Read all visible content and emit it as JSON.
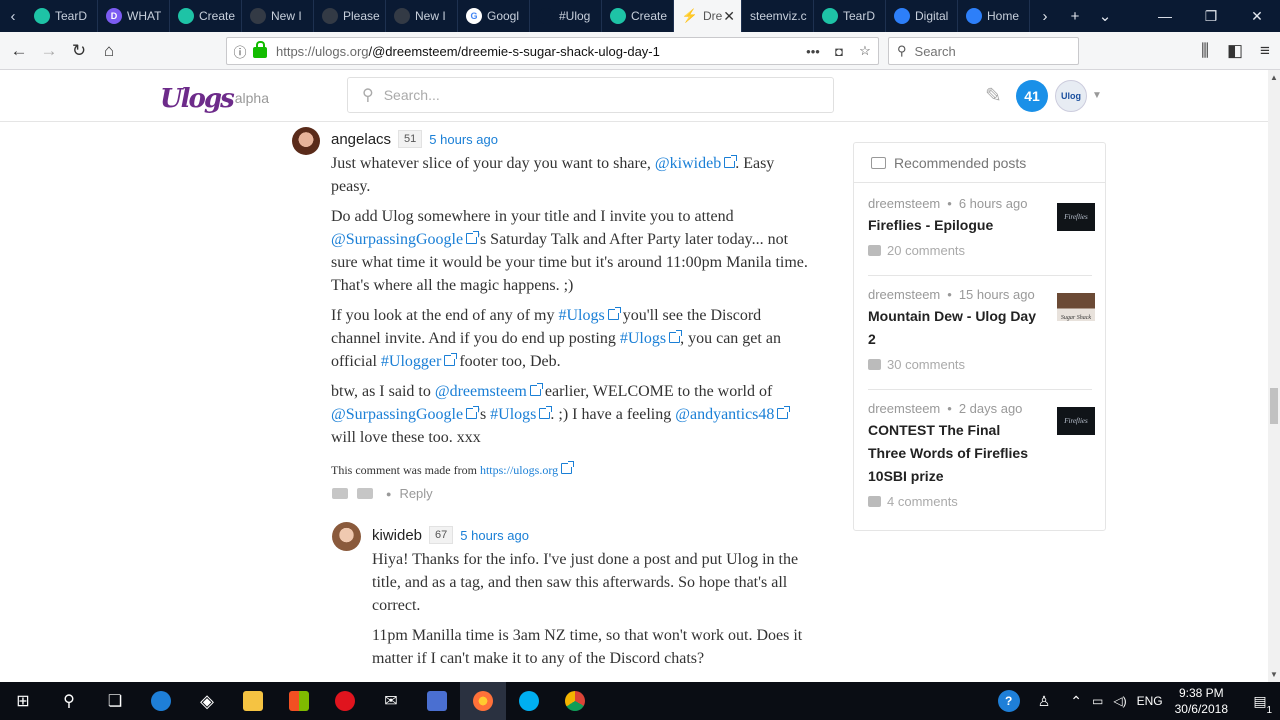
{
  "browser": {
    "tabs": [
      {
        "label": "TearD",
        "icon": "steemit-icon",
        "color": "#1ec3a6"
      },
      {
        "label": "WHAT",
        "icon": "discord-icon",
        "color": "#7c5cf2"
      },
      {
        "label": "Create",
        "icon": "steemit-icon",
        "color": "#1ec3a6"
      },
      {
        "label": "New I",
        "icon": "github-icon",
        "color": "#333a45"
      },
      {
        "label": "Please",
        "icon": "github-icon",
        "color": "#333a45"
      },
      {
        "label": "New I",
        "icon": "github-icon",
        "color": "#333a45"
      },
      {
        "label": "Googl",
        "icon": "google-icon",
        "color": "#ffffff"
      },
      {
        "label": "#Ulog",
        "icon": "ulog-icon",
        "color": "#0a1a33"
      },
      {
        "label": "Create",
        "icon": "steemit-icon",
        "color": "#1ec3a6"
      },
      {
        "label": "Dre",
        "icon": "lightning-icon",
        "color": "#f5f6f7",
        "active": true
      },
      {
        "label": "steemviz.c",
        "icon": "none",
        "color": "#0a1a33"
      },
      {
        "label": "TearD",
        "icon": "steemit-icon",
        "color": "#1ec3a6"
      },
      {
        "label": "Digital",
        "icon": "busy-icon",
        "color": "#2d7ff9"
      },
      {
        "label": "Home",
        "icon": "busy-icon",
        "color": "#2d7ff9"
      }
    ],
    "url_prefix": "https://ulogs.org",
    "url_path": "/@dreemsteem/dreemie-s-sugar-shack-ulog-day-1",
    "search_placeholder": "Search"
  },
  "site": {
    "logo_text": "Ulogs",
    "logo_suffix": "alpha",
    "search_placeholder": "Search...",
    "notification_count": "41",
    "avatar_text": "Ulog"
  },
  "comments": [
    {
      "author": "angelacs",
      "reputation": "51",
      "time": "5 hours ago",
      "p1_a": "Just whatever slice of your day you want to share, ",
      "p1_link": "@kiwideb",
      "p1_b": ". Easy peasy.",
      "p2_a": "Do add Ulog somewhere in your title and I invite you to attend ",
      "p2_link": "@SurpassingGoogle",
      "p2_b": "'s Saturday Talk and After Party later today... not sure what time it would be your time but it's around 11:00pm Manila time. That's where all the magic happens. ;)",
      "p3_a": "If you look at the end of any of my ",
      "p3_link1": "#Ulogs",
      "p3_b": " you'll see the Discord channel invite. And if you do end up posting ",
      "p3_link2": "#Ulogs",
      "p3_c": ", you can get an official ",
      "p3_link3": "#Ulogger",
      "p3_d": " footer too, Deb.",
      "p4_a": "btw, as I said to ",
      "p4_link1": "@dreemsteem",
      "p4_b": " earlier, WELCOME to the world of ",
      "p4_link2": "@SurpassingGoogle",
      "p4_c": "'s ",
      "p4_link3": "#Ulogs",
      "p4_d": ". ;) I have a feeling ",
      "p4_link4": "@andyantics48",
      "p4_e": " will love these too. xxx",
      "made_from": "This comment was made from ",
      "made_from_link": "https://ulogs.org",
      "reply": "Reply"
    },
    {
      "author": "kiwideb",
      "reputation": "67",
      "time": "5 hours ago",
      "p1": "Hiya! Thanks for the info. I've just done a post and put Ulog in the title, and as a tag, and then saw this afterwards. So hope that's all correct.",
      "p2": "11pm Manilla time is 3am NZ time, so that won't work out. Does it matter if I can't make it to any of the Discord chats?"
    }
  ],
  "recommended": {
    "heading": "Recommended posts",
    "items": [
      {
        "author": "dreemsteem",
        "time": "6 hours ago",
        "title": "Fireflies - Epilogue",
        "comments": "20 comments",
        "thumb": "Fireflies"
      },
      {
        "author": "dreemsteem",
        "time": "15 hours ago",
        "title": "Mountain Dew - Ulog Day 2",
        "comments": "30 comments",
        "thumb": "Sugar Shack"
      },
      {
        "author": "dreemsteem",
        "time": "2 days ago",
        "title": "CONTEST The Final Three Words of Fireflies 10SBI prize",
        "comments": "4 comments",
        "thumb": "Fireflies"
      }
    ]
  },
  "taskbar": {
    "time": "9:38 PM",
    "date": "30/6/2018",
    "lang": "ENG",
    "notifications": "1"
  }
}
